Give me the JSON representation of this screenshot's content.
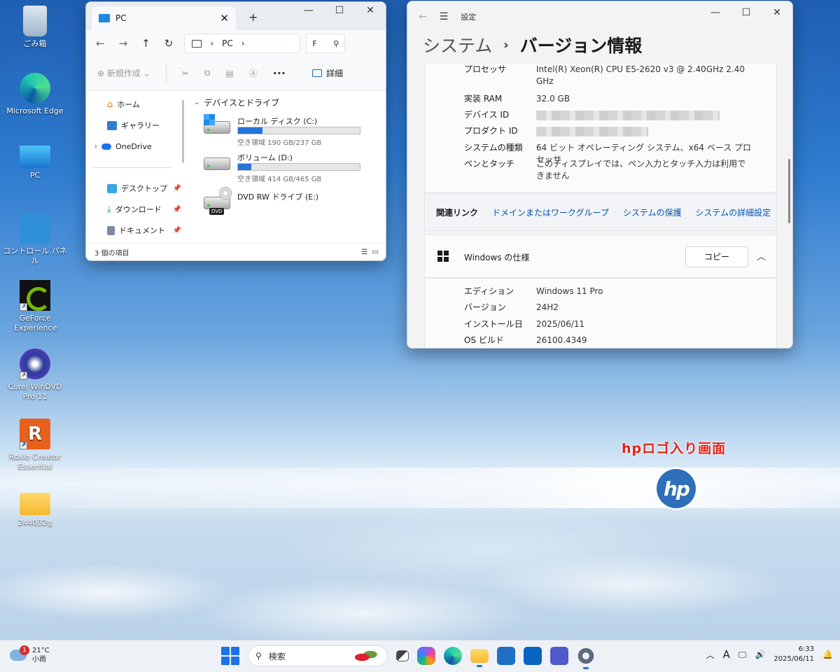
{
  "desktop": {
    "icons": [
      {
        "label": "ごみ箱",
        "icon": "recycle-bin-icon"
      },
      {
        "label": "Microsoft Edge",
        "icon": "edge-icon"
      },
      {
        "label": "PC",
        "icon": "pc-monitor-icon"
      },
      {
        "label": "コントロール パネル",
        "icon": "control-panel-icon"
      },
      {
        "label": "GeForce Experience",
        "icon": "geforce-icon"
      },
      {
        "label": "Corel WinDVD Pro 11",
        "icon": "windvd-icon"
      },
      {
        "label": "Roxio Creator Essential",
        "icon": "roxio-icon"
      },
      {
        "label": "244032g",
        "icon": "folder-icon"
      }
    ],
    "annotation": "hpロゴ入り画面",
    "logo_text": "hp"
  },
  "explorer": {
    "tab_title": "PC",
    "address": {
      "item": "PC",
      "search_text": "F"
    },
    "toolbar": {
      "new_label": "新規作成",
      "details_label": "詳細"
    },
    "sidebar": [
      {
        "label": "ホーム",
        "icon": "home-icon"
      },
      {
        "label": "ギャラリー",
        "icon": "gallery-icon"
      },
      {
        "label": "OneDrive",
        "icon": "onedrive-icon"
      },
      {
        "label": "デスクトップ",
        "icon": "desktop-folder-icon"
      },
      {
        "label": "ダウンロード",
        "icon": "download-icon"
      },
      {
        "label": "ドキュメント",
        "icon": "documents-icon"
      }
    ],
    "group_title": "デバイスとドライブ",
    "drives": [
      {
        "name": "ローカル ディスク (C:)",
        "free": "空き領域 190 GB/237 GB",
        "used_fraction": 0.2
      },
      {
        "name": "ボリューム (D:)",
        "free": "空き領域 414 GB/465 GB",
        "used_fraction": 0.11
      },
      {
        "name": "DVD RW ドライブ (E:)",
        "free": "",
        "badge": "DVD"
      }
    ],
    "status": "3 個の項目"
  },
  "settings": {
    "app_title": "設定",
    "breadcrumb": "システム",
    "page_title": "バージョン情報",
    "device_specs": [
      {
        "key": "プロセッサ",
        "value": "Intel(R) Xeon(R) CPU E5-2620 v3 @ 2.40GHz   2.40 GHz"
      },
      {
        "key": "実装 RAM",
        "value": "32.0 GB"
      },
      {
        "key": "デバイス ID",
        "value": ""
      },
      {
        "key": "プロダクト ID",
        "value": ""
      },
      {
        "key": "システムの種類",
        "value": "64 ビット オペレーティング システム、x64 ベース プロセッサ"
      },
      {
        "key": "ペンとタッチ",
        "value": "このディスプレイでは、ペン入力とタッチ入力は利用できません"
      }
    ],
    "related_links": {
      "label": "関連リンク",
      "links": [
        "ドメインまたはワークグループ",
        "システムの保護",
        "システムの詳細設定"
      ]
    },
    "windows_spec": {
      "title": "Windows の仕様",
      "copy_label": "コピー",
      "rows": [
        {
          "key": "エディション",
          "value": "Windows 11 Pro"
        },
        {
          "key": "バージョン",
          "value": "24H2"
        },
        {
          "key": "インストール日",
          "value": "2025/06/11"
        },
        {
          "key": "OS ビルド",
          "value": "26100.4349"
        }
      ]
    }
  },
  "taskbar": {
    "weather": {
      "temp": "21°C",
      "condition": "小雨",
      "badge": "1"
    },
    "search_placeholder": "検索",
    "apps": [
      "task-view-icon",
      "copilot-icon",
      "edge-icon",
      "file-explorer-icon",
      "store-icon",
      "outlook-icon",
      "teams-icon",
      "settings-gear-icon"
    ],
    "tray": {
      "ime": "A"
    },
    "time": "6:33",
    "date": "2025/06/11"
  }
}
